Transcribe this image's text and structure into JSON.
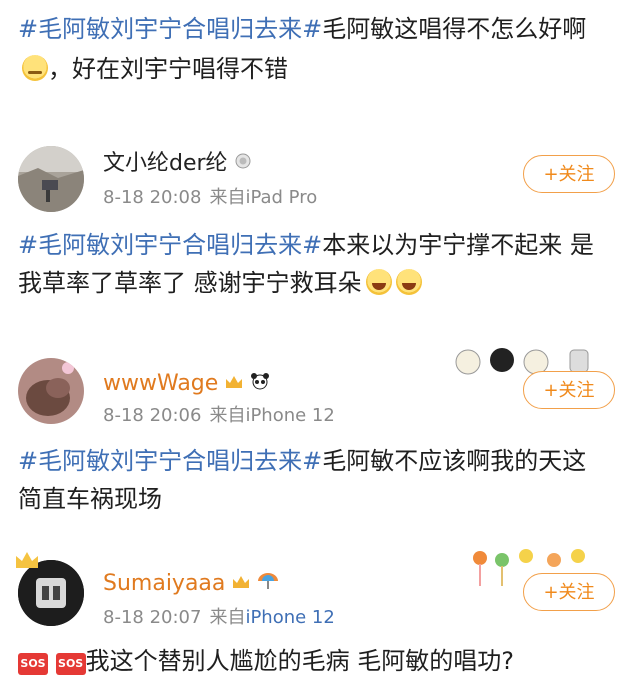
{
  "post0": {
    "line1_hashtag": "#毛阿敏刘宇宁合唱归去来#",
    "line1_text": "毛阿敏这唱得不怎么好啊",
    "line2_text": "，好在刘宇宁唱得不错",
    "emoji": "sweat-emoji"
  },
  "comments": [
    {
      "username": "文小纶der纶",
      "time": "8-18 20:08",
      "source_prefix": "来自",
      "source": "iPad Pro",
      "follow_label": "+关注",
      "line1_hashtag": "#毛阿敏刘宇宁合唱归去来#",
      "line1_text": "本来以为宇宁撑不起来 是",
      "line2_text": "我草率了草率了 感谢宇宁救耳朵"
    },
    {
      "username": "wwwWage",
      "time": "8-18 20:06",
      "source_prefix": "来自",
      "source": "iPhone 12",
      "follow_label": "+关注",
      "line1_hashtag": "#毛阿敏刘宇宁合唱归去来#",
      "line1_text": "毛阿敏不应该啊我的天这",
      "line2_text": "简直车祸现场"
    },
    {
      "username": "Sumaiyaaa",
      "time": "8-18 20:07",
      "source_prefix": "来自",
      "source": "iPhone 12",
      "follow_label": "+关注",
      "line1_sos": "SOS",
      "line1_text": "我这个替别人尴尬的毛病 毛阿敏的唱功?"
    }
  ],
  "colors": {
    "hashtag": "#3f6fb5",
    "username_vip": "#e07a1f",
    "follow": "#f08a1c",
    "meta": "#8a8a8a"
  }
}
